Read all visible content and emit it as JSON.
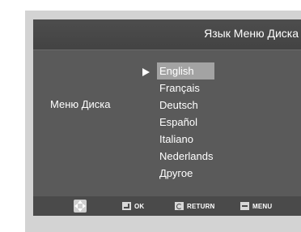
{
  "title": "Язык Меню Диска",
  "side_label": "Меню Диска",
  "languages": [
    "English",
    "Français",
    "Deutsch",
    "Español",
    "Italiano",
    "Nederlands",
    "Другое"
  ],
  "selected_language": "English",
  "footer": {
    "nav_icon": "directional-pad-icon",
    "ok_icon": "enter-icon",
    "ok_label": "OK",
    "return_icon": "return-icon",
    "return_label": "RETURN",
    "menu_icon": "menu-icon",
    "menu_label": "MENU"
  },
  "colors": {
    "panel_bg": "#5a5a5a",
    "title_bar_bg": "#4d4d4d",
    "selection_bg": "#a3a3a3",
    "footer_bg": "#4a4a4a",
    "frame_bg": "#d3d3d3",
    "text": "#ffffff"
  }
}
